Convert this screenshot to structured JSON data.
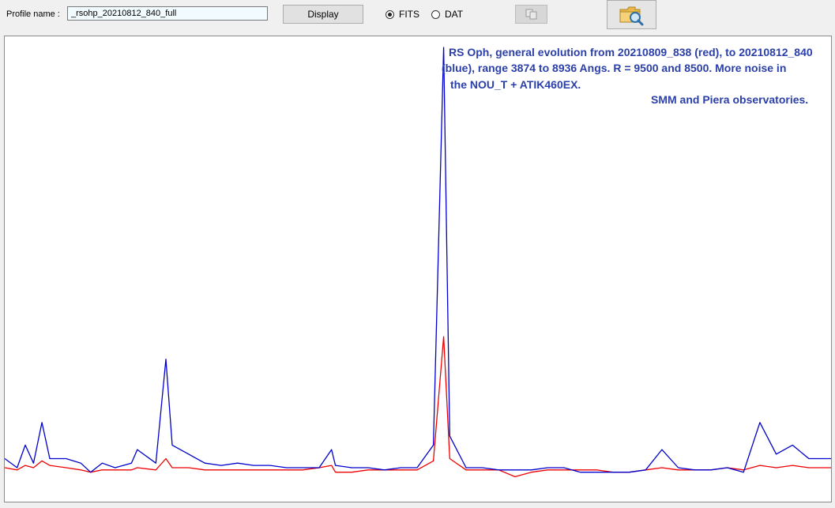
{
  "toolbar": {
    "profile_label": "Profile name :",
    "profile_value": "_rsohp_20210812_840_full",
    "display_label": "Display",
    "radio_fits": "FITS",
    "radio_dat": "DAT",
    "selected_format": "FITS",
    "copy_icon": "copy-icon",
    "open_icon": "folder-search-icon"
  },
  "plot": {
    "annotation_lines": [
      "RS Oph, general evolution from 20210809_838 (red), to 20210812_840",
      "(blue), range 3874 to 8936 Angs. R = 9500 and 8500.  More noise in",
      "the NOU_T + ATIK460EX.",
      "SMM and Piera observatories."
    ]
  },
  "colors": {
    "annotation": "#2b3fa8",
    "blue_spectrum": "#0000cc",
    "red_spectrum": "#ee0000"
  },
  "chart_data": {
    "type": "line",
    "title": "",
    "xlabel": "",
    "ylabel": "",
    "xlim": [
      3874,
      8936
    ],
    "ylim": [
      0,
      1
    ],
    "grid": false,
    "legend": "none",
    "x": [
      3874,
      3950,
      4000,
      4050,
      4102,
      4150,
      4250,
      4340,
      4400,
      4471,
      4550,
      4650,
      4686,
      4800,
      4861,
      4900,
      5000,
      5100,
      5200,
      5300,
      5400,
      5500,
      5600,
      5700,
      5800,
      5876,
      5900,
      6000,
      6100,
      6200,
      6300,
      6400,
      6500,
      6563,
      6600,
      6700,
      6800,
      6900,
      7000,
      7100,
      7200,
      7300,
      7400,
      7500,
      7600,
      7700,
      7800,
      7900,
      8000,
      8100,
      8200,
      8300,
      8400,
      8500,
      8600,
      8700,
      8800,
      8936
    ],
    "series": [
      {
        "name": "20210812_840",
        "color": "#0000cc",
        "values": [
          0.09,
          0.07,
          0.12,
          0.08,
          0.17,
          0.09,
          0.09,
          0.08,
          0.06,
          0.08,
          0.07,
          0.08,
          0.11,
          0.08,
          0.31,
          0.12,
          0.1,
          0.08,
          0.075,
          0.08,
          0.075,
          0.075,
          0.07,
          0.07,
          0.07,
          0.11,
          0.075,
          0.07,
          0.07,
          0.065,
          0.07,
          0.07,
          0.12,
          1.0,
          0.14,
          0.07,
          0.07,
          0.065,
          0.065,
          0.065,
          0.07,
          0.07,
          0.06,
          0.06,
          0.06,
          0.06,
          0.065,
          0.11,
          0.07,
          0.065,
          0.065,
          0.07,
          0.06,
          0.17,
          0.1,
          0.12,
          0.09,
          0.09
        ]
      },
      {
        "name": "20210809_838",
        "color": "#ee0000",
        "values": [
          0.07,
          0.065,
          0.075,
          0.07,
          0.085,
          0.075,
          0.07,
          0.065,
          0.06,
          0.065,
          0.065,
          0.065,
          0.07,
          0.065,
          0.09,
          0.07,
          0.07,
          0.065,
          0.065,
          0.065,
          0.065,
          0.065,
          0.065,
          0.065,
          0.07,
          0.075,
          0.06,
          0.06,
          0.065,
          0.065,
          0.065,
          0.065,
          0.085,
          0.36,
          0.09,
          0.065,
          0.065,
          0.065,
          0.05,
          0.06,
          0.065,
          0.065,
          0.065,
          0.065,
          0.06,
          0.06,
          0.065,
          0.07,
          0.065,
          0.065,
          0.065,
          0.07,
          0.065,
          0.075,
          0.07,
          0.075,
          0.07,
          0.07
        ]
      }
    ]
  }
}
